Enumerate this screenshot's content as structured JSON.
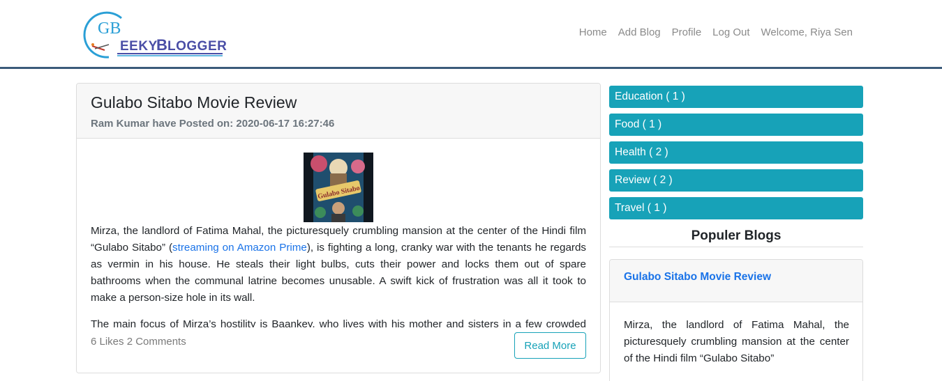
{
  "brand": {
    "logo_monogram": "GB",
    "logo_text": "GeekyBlogger"
  },
  "nav": {
    "items": [
      {
        "label": "Home"
      },
      {
        "label": "Add Blog"
      },
      {
        "label": "Profile"
      },
      {
        "label": "Log Out"
      },
      {
        "label": "Welcome, Riya Sen"
      }
    ]
  },
  "post": {
    "title": "Gulabo Sitabo Movie Review",
    "meta": "Ram Kumar have Posted on: 2020-06-17 16:27:46",
    "poster_caption": "Gulabo Sitabo",
    "para1_before": "Mirza, the landlord of Fatima Mahal, the picturesquely crumbling mansion at the center of the Hindi film “Gulabo Sitabo” (",
    "para1_link": "streaming on Amazon Prime",
    "para1_after": "), is fighting a long, cranky war with the tenants he regards as vermin in his house. He steals their light bulbs, cuts their power and locks them out of spare bathrooms when the communal latrine becomes unusable. A swift kick of frustration was all it took to make a person-size hole in its wall.",
    "para2": "The main focus of Mirza’s hostility is Baankey, who lives with his mother and sisters in a few crowded rooms.",
    "stats": "6 Likes 2 Comments",
    "read_more": "Read More"
  },
  "sidebar": {
    "categories": [
      {
        "label": "Education ( 1 )"
      },
      {
        "label": "Food ( 1 )"
      },
      {
        "label": "Health ( 2 )"
      },
      {
        "label": "Review ( 2 )"
      },
      {
        "label": "Travel ( 1 )"
      }
    ],
    "popular_heading": "Populer Blogs",
    "popular": {
      "title": "Gulabo Sitabo Movie Review",
      "excerpt": "Mirza, the landlord of Fatima Mahal, the picturesquely crumbling mansion at the center of the Hindi film “Gulabo Sitabo”"
    }
  },
  "colors": {
    "accent": "#17a2b8",
    "link": "#1a73e8",
    "nav_border": "#3b5b7a",
    "logo_blue": "#2a9fd6"
  }
}
